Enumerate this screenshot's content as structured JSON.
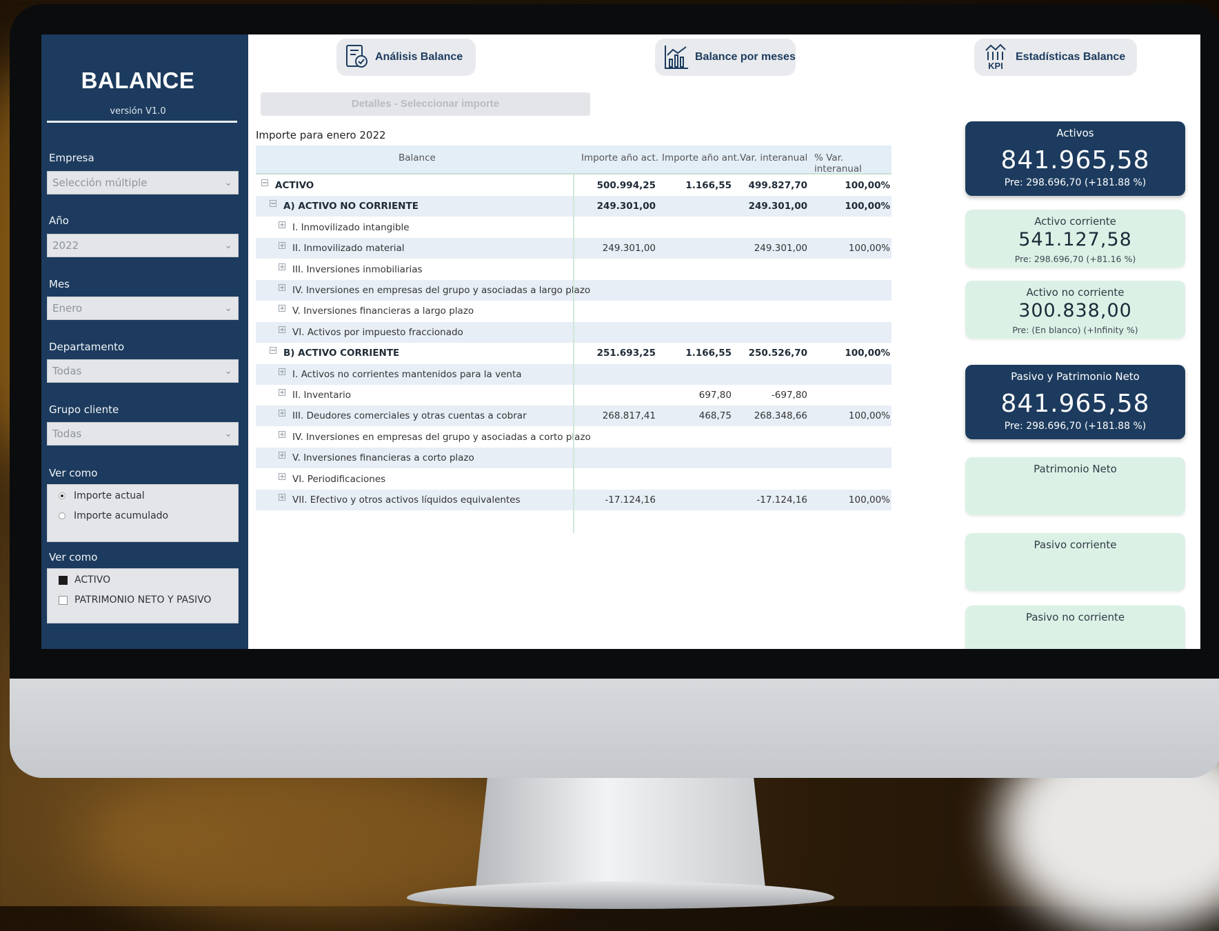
{
  "app": {
    "title": "BALANCE",
    "version": "versión V1.0"
  },
  "filters": {
    "empresa": {
      "label": "Empresa",
      "value": "Selección múltiple"
    },
    "anio": {
      "label": "Año",
      "value": "2022"
    },
    "mes": {
      "label": "Mes",
      "value": "Enero"
    },
    "departamento": {
      "label": "Departamento",
      "value": "Todas"
    },
    "grupo_cliente": {
      "label": "Grupo cliente",
      "value": "Todas"
    }
  },
  "ver_como_1": {
    "label": "Ver como",
    "options": [
      "Importe actual",
      "Importe acumulado"
    ],
    "selected": 0
  },
  "ver_como_2": {
    "label": "Ver como",
    "options": [
      "ACTIVO",
      "PATRIMONIO NETO Y PASIVO"
    ],
    "checked": [
      true,
      false
    ]
  },
  "nav": {
    "analisis": "Análisis Balance",
    "por_meses": "Balance por meses",
    "estadisticas": "Estadísticas Balance",
    "kpi_icon_text": "KPI"
  },
  "detail_button": "Detalles - Seleccionar importe",
  "table": {
    "caption": "Importe para enero 2022",
    "headers": [
      "Balance",
      "Importe año act.",
      "Importe año ant.",
      "Var. interanual",
      "% Var. interanual"
    ],
    "rows": [
      {
        "label": "ACTIVO",
        "expander": "−",
        "v1": "500.994,25",
        "v2": "1.166,55",
        "v3": "499.827,70",
        "v4": "100,00%"
      },
      {
        "label": "A) ACTIVO NO CORRIENTE",
        "expander": "−",
        "v1": "249.301,00",
        "v2": "",
        "v3": "249.301,00",
        "v4": "100,00%"
      },
      {
        "label": "I. Inmovilizado intangible",
        "expander": "+",
        "v1": "",
        "v2": "",
        "v3": "",
        "v4": ""
      },
      {
        "label": "II. Inmovilizado material",
        "expander": "+",
        "v1": "249.301,00",
        "v2": "",
        "v3": "249.301,00",
        "v4": "100,00%"
      },
      {
        "label": "III. Inversiones inmobiliarias",
        "expander": "+",
        "v1": "",
        "v2": "",
        "v3": "",
        "v4": ""
      },
      {
        "label": "IV. Inversiones en empresas del grupo y asociadas a largo plazo",
        "expander": "+",
        "v1": "",
        "v2": "",
        "v3": "",
        "v4": ""
      },
      {
        "label": "V. Inversiones financieras a largo plazo",
        "expander": "+",
        "v1": "",
        "v2": "",
        "v3": "",
        "v4": ""
      },
      {
        "label": "VI. Activos por impuesto fraccionado",
        "expander": "+",
        "v1": "",
        "v2": "",
        "v3": "",
        "v4": ""
      },
      {
        "label": "B) ACTIVO CORRIENTE",
        "expander": "−",
        "v1": "251.693,25",
        "v2": "1.166,55",
        "v3": "250.526,70",
        "v4": "100,00%"
      },
      {
        "label": "I. Activos no corrientes mantenidos para la venta",
        "expander": "+",
        "v1": "",
        "v2": "",
        "v3": "",
        "v4": ""
      },
      {
        "label": "II. Inventario",
        "expander": "+",
        "v1": "",
        "v2": "697,80",
        "v3": "-697,80",
        "v4": ""
      },
      {
        "label": "III. Deudores comerciales y otras cuentas a cobrar",
        "expander": "+",
        "v1": "268.817,41",
        "v2": "468,75",
        "v3": "268.348,66",
        "v4": "100,00%"
      },
      {
        "label": "IV. Inversiones en empresas del grupo y asociadas a corto plazo",
        "expander": "+",
        "v1": "",
        "v2": "",
        "v3": "",
        "v4": ""
      },
      {
        "label": "V. Inversiones financieras a corto plazo",
        "expander": "+",
        "v1": "",
        "v2": "",
        "v3": "",
        "v4": ""
      },
      {
        "label": "VI. Periodificaciones",
        "expander": "+",
        "v1": "",
        "v2": "",
        "v3": "",
        "v4": ""
      },
      {
        "label": "VII. Efectivo y otros activos líquidos equivalentes",
        "expander": "+",
        "v1": "-17.124,16",
        "v2": "",
        "v3": "-17.124,16",
        "v4": "100,00%"
      }
    ]
  },
  "kpis": {
    "activos": {
      "title": "Activos",
      "value": "841.965,58",
      "sub": "Pre: 298.696,70 (+181.88 %)"
    },
    "activo_corriente": {
      "title": "Activo corriente",
      "value": "541.127,58",
      "sub": "Pre: 298.696,70 (+81.16 %)"
    },
    "activo_no_corriente": {
      "title": "Activo no corriente",
      "value": "300.838,00",
      "sub": "Pre: (En blanco) (+Infinity %)"
    },
    "pasivo_patrimonio": {
      "title": "Pasivo y Patrimonio Neto",
      "value": "841.965,58",
      "sub": "Pre: 298.696,70 (+181.88 %)"
    },
    "patrimonio_neto": {
      "title": "Patrimonio Neto"
    },
    "pasivo_corriente": {
      "title": "Pasivo corriente"
    },
    "pasivo_no_corriente": {
      "title": "Pasivo no corriente"
    }
  },
  "colors": {
    "navy": "#1c3b5e",
    "mint": "#dcf1e6",
    "table_stripe": "#e7eef6",
    "accent_line": "#cfe8d8"
  },
  "icons": [
    "chevron-down-icon",
    "analysis-report-icon",
    "bar-chart-icon",
    "kpi-icon",
    "expand-icon",
    "collapse-icon"
  ]
}
